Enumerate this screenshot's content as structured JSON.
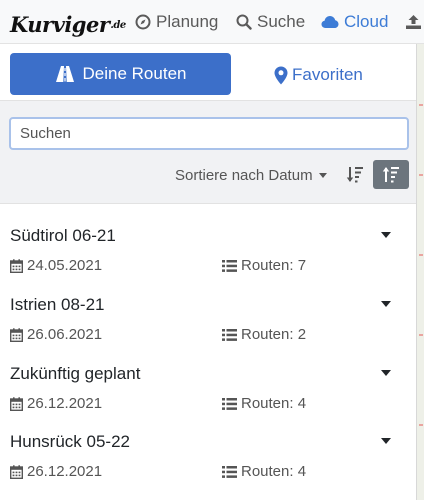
{
  "app": {
    "logo_text": "Kurviger",
    "logo_tld": ".de"
  },
  "nav": {
    "items": [
      {
        "label": "Planung",
        "icon": "compass-icon"
      },
      {
        "label": "Suche",
        "icon": "search-icon"
      },
      {
        "label": "Cloud",
        "icon": "cloud-icon",
        "active": true
      },
      {
        "label": "",
        "icon": "upload-icon"
      }
    ]
  },
  "tabs": {
    "routes_label": "Deine Routen",
    "favorites_label": "Favoriten"
  },
  "filter": {
    "search_placeholder": "Suchen",
    "search_value": "",
    "sort_label": "Sortiere nach Datum",
    "sort_desc_icon": "sort-amount-down-icon",
    "sort_asc_icon": "sort-amount-up-icon",
    "active_sort": "asc"
  },
  "routes": [
    {
      "title": "Südtirol 06-21",
      "date": "24.05.2021",
      "count": "Routen: 7"
    },
    {
      "title": "Istrien 08-21",
      "date": "26.06.2021",
      "count": "Routen: 2"
    },
    {
      "title": "Zukünftig geplant",
      "date": "26.12.2021",
      "count": "Routen: 4"
    },
    {
      "title": "Hunsrück 05-22",
      "date": "26.12.2021",
      "count": "Routen: 4"
    }
  ],
  "colors": {
    "primary": "#3c6fc9",
    "active_nav": "#3d7cd6",
    "sort_active_bg": "#6c757d",
    "filter_bg": "#f1f2f4"
  }
}
